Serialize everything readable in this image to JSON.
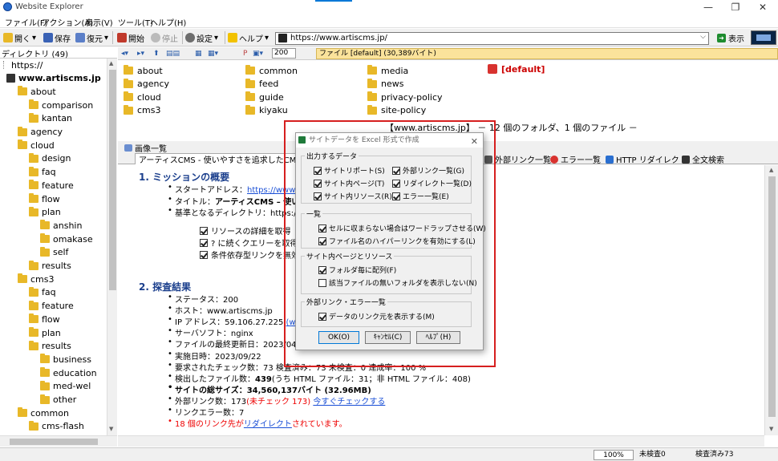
{
  "window": {
    "title": "Website Explorer",
    "min": "—",
    "max": "❐",
    "close": "✕"
  },
  "menu": [
    "ファイル(F)",
    "アクション(A)",
    "表示(V)",
    "ツール(T)",
    "ヘルプ(H)"
  ],
  "toolbar": {
    "open": "開く",
    "save": "保存",
    "restore": "復元",
    "start": "開始",
    "stop": "停止",
    "settings": "設定",
    "help": "ヘルプ",
    "go": "表示",
    "address": "https://www.artiscms.jp/",
    "dropdown_arrow": "▾",
    "combo_arrow": "⌵"
  },
  "directory": {
    "header": "ディレクトリ (49)",
    "items": [
      {
        "label": "https://",
        "level": 0,
        "type": "root"
      },
      {
        "label": "www.artiscms.jp",
        "level": 1,
        "type": "site"
      },
      {
        "label": "about",
        "level": 2,
        "type": "folder"
      },
      {
        "label": "comparison",
        "level": 3,
        "type": "folder"
      },
      {
        "label": "kantan",
        "level": 3,
        "type": "folder"
      },
      {
        "label": "agency",
        "level": 2,
        "type": "folder"
      },
      {
        "label": "cloud",
        "level": 2,
        "type": "folder"
      },
      {
        "label": "design",
        "level": 3,
        "type": "folder"
      },
      {
        "label": "faq",
        "level": 3,
        "type": "folder"
      },
      {
        "label": "feature",
        "level": 3,
        "type": "folder"
      },
      {
        "label": "flow",
        "level": 3,
        "type": "folder"
      },
      {
        "label": "plan",
        "level": 3,
        "type": "folder"
      },
      {
        "label": "anshin",
        "level": 4,
        "type": "folder"
      },
      {
        "label": "omakase",
        "level": 4,
        "type": "folder"
      },
      {
        "label": "self",
        "level": 4,
        "type": "folder"
      },
      {
        "label": "results",
        "level": 3,
        "type": "folder"
      },
      {
        "label": "cms3",
        "level": 2,
        "type": "folder"
      },
      {
        "label": "faq",
        "level": 3,
        "type": "folder"
      },
      {
        "label": "feature",
        "level": 3,
        "type": "folder"
      },
      {
        "label": "flow",
        "level": 3,
        "type": "folder"
      },
      {
        "label": "plan",
        "level": 3,
        "type": "folder"
      },
      {
        "label": "results",
        "level": 3,
        "type": "folder"
      },
      {
        "label": "business",
        "level": 4,
        "type": "folder"
      },
      {
        "label": "education",
        "level": 4,
        "type": "folder"
      },
      {
        "label": "med-wel",
        "level": 4,
        "type": "folder"
      },
      {
        "label": "other",
        "level": 4,
        "type": "folder"
      },
      {
        "label": "common",
        "level": 2,
        "type": "folder"
      },
      {
        "label": "cms-flash",
        "level": 3,
        "type": "folder"
      }
    ]
  },
  "nav": {
    "zoom": "200",
    "file_status": "ファイル [default] (30,389バイト)"
  },
  "folders": [
    "about",
    "agency",
    "cloud",
    "cms3",
    "common",
    "feed",
    "guide",
    "kiyaku",
    "media",
    "news",
    "privacy-policy",
    "site-policy"
  ],
  "default_label": "[default]",
  "summary": "【www.artiscms.jp】 － 12 個のフォルダ、1 個のファイル －",
  "tabs": {
    "image_list": "画像一覧",
    "active": "アーティスCMS - 使いやすさを追求したCMS",
    "external_links": "外部リンク一覧",
    "errors": "エラー一覧",
    "redirects": "HTTP リダイレクト",
    "search": "全文検索"
  },
  "content": {
    "h1": "1. ミッションの概要",
    "start_label": "スタートアドレス：",
    "start_url": "https://www.art",
    "title_label": "タイトル：",
    "title_value": "アーティスCMS – 使いや",
    "basedir": "基準となるディレクトリ：https://ww",
    "opt1": "リソースの詳細を取得",
    "opt2": "? に続くクエリーを取得",
    "opt3": "条件依存型リンクを無効",
    "h2": "2. 探査結果",
    "status": "ステータス：200",
    "host": "ホスト：www.artiscms.jp",
    "ip_label": "IP アドレス：59.106.27.225 ",
    "ip_link": "(www15",
    "server": "サーバソフト：nginx",
    "lastmod": "ファイルの最終更新日：2023/04/",
    "date": "実施日時：2023/09/22",
    "checks": "要求されたチェック数：73 検査済み：73 未検査：0 達成率：100 %",
    "files": "検出したファイル数：",
    "files_bold": "439",
    "files_rest": "(うち HTML ファイル：31；非 HTML ファイル：408)",
    "size": "サイトの総サイズ：34,560,137バイト (32.96MB)",
    "ext_label": "外部リンク数：173",
    "ext_red": "(未チェック 173)",
    "ext_link": "今すぐチェックする",
    "link_err": "リンクエラー数：7",
    "redirect_pre": "18 個のリンク先が",
    "redirect_link": "リダイレクト",
    "redirect_post": "されています。"
  },
  "status": {
    "zoom": "100%",
    "unchecked": "未検査0",
    "checked": "検査済み73"
  },
  "dialog": {
    "title": "サイトデータを Excel 形式で作成",
    "close": "✕",
    "g1": "出力するデータ",
    "g1_items": [
      {
        "label": "サイトリポート(S)",
        "checked": true
      },
      {
        "label": "外部リンク一覧(G)",
        "checked": true
      },
      {
        "label": "サイト内ページ(T)",
        "checked": true
      },
      {
        "label": "リダイレクト一覧(D)",
        "checked": true
      },
      {
        "label": "サイト内リソース(R)",
        "checked": true
      },
      {
        "label": "エラー一覧(E)",
        "checked": true
      }
    ],
    "g2": "一覧",
    "g2_items": [
      {
        "label": "セルに収まらない場合はワードラップさせる(W)",
        "checked": true
      },
      {
        "label": "ファイル名のハイパーリンクを有効にする(L)",
        "checked": true
      }
    ],
    "g3": "サイト内ページとリソース",
    "g3_items": [
      {
        "label": "フォルダ毎に配列(F)",
        "checked": true
      },
      {
        "label": "該当ファイルの無いフォルダを表示しない(N)",
        "checked": false
      }
    ],
    "g4": "外部リンク・エラー一覧",
    "g4_items": [
      {
        "label": "データのリンク元を表示する(M)",
        "checked": true
      }
    ],
    "ok": "OK(O)",
    "cancel": "ｷｬﾝｾﾙ(C)",
    "help": "ﾍﾙﾌﾟ(H)"
  },
  "colors": {
    "highlight": "#d61f1f",
    "folder": "#e8b828",
    "heading": "#1a3e8c",
    "link": "#1a4fd6",
    "status_bg": "#fbe39b"
  }
}
